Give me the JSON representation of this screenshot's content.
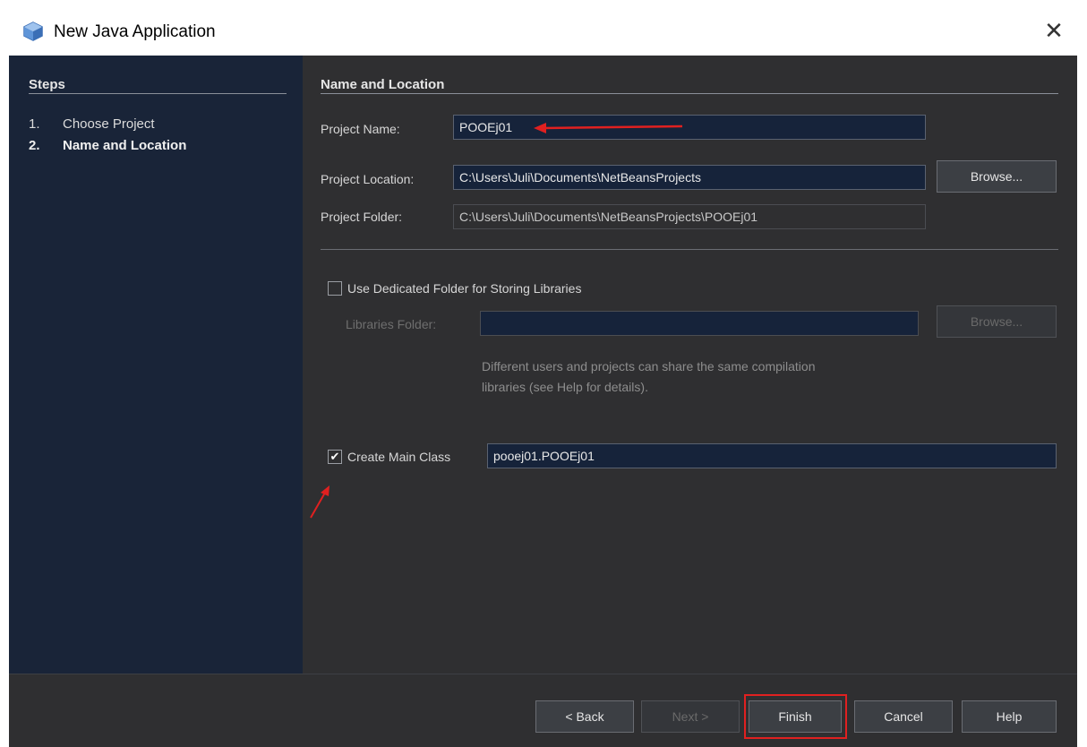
{
  "window": {
    "title": "New Java Application"
  },
  "steps": {
    "heading": "Steps",
    "items": [
      {
        "num": "1.",
        "label": "Choose Project"
      },
      {
        "num": "2.",
        "label": "Name and Location"
      }
    ]
  },
  "section": {
    "heading": "Name and Location"
  },
  "project": {
    "name_label": "Project Name:",
    "name_value": "POOEj01",
    "location_label": "Project Location:",
    "location_value": "C:\\Users\\Juli\\Documents\\NetBeansProjects",
    "browse_label": "Browse...",
    "folder_label": "Project Folder:",
    "folder_value": "C:\\Users\\Juli\\Documents\\NetBeansProjects\\POOEj01"
  },
  "libraries": {
    "checkbox_label": "Use Dedicated Folder for Storing Libraries",
    "checked": false,
    "folder_label": "Libraries Folder:",
    "folder_value": "",
    "browse_label": "Browse...",
    "hint_line1": "Different users and projects can share the same compilation",
    "hint_line2": "libraries (see Help for details)."
  },
  "main_class": {
    "checkbox_label": "Create Main Class",
    "checked": true,
    "check_glyph": "✔",
    "value": "pooej01.POOEj01"
  },
  "footer": {
    "back": "< Back",
    "next": "Next >",
    "finish": "Finish",
    "cancel": "Cancel",
    "help": "Help"
  },
  "colors": {
    "annotation": "#e02020",
    "steps_bg": "#192438",
    "panel_bg": "#2f2f31",
    "field_bg": "#16233a"
  }
}
